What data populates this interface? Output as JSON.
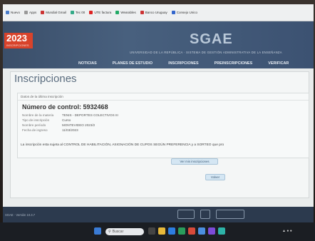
{
  "bookmarks": [
    "Nuevo",
    "Apps",
    "Mundial Gmail",
    "Tec 00",
    "UTE factura",
    "Wearables",
    "Banco Uruguay",
    "Consejo Unico"
  ],
  "header": {
    "year": "2023",
    "year_sub": "INSCRIPCIONES",
    "logo": "SGAE",
    "subtitle": "UNIVERSIDAD DE LA REPÚBLICA · SISTEMA DE GESTIÓN ADMINISTRATIVA DE LA ENSEÑANZA",
    "nav": [
      "NOTICIAS",
      "PLANES DE ESTUDIO",
      "INSCRIPCIONES",
      "PREINSCRIPCIONES",
      "VERIFICAR"
    ]
  },
  "page_title": "Inscripciones",
  "card": {
    "heading": "Datos de la última inscripción",
    "control_label": "Número de control:",
    "control_value": "5932468",
    "rows": [
      {
        "label": "Nombre de la materia",
        "value": "TENIS - DEPORTES COLECTIVOS III"
      },
      {
        "label": "Tipo de inscripción",
        "value": "Curso"
      },
      {
        "label": "Nombre período",
        "value": "MONTEVIDEO 2023/2"
      },
      {
        "label": "Fecha de ingreso",
        "value": "11/03/2023"
      }
    ],
    "note": "La inscripción esta sujeta al CONTROL DE HABILITACIÓN, ASIGNACIÓN DE CUPOS SEGÚN PREFERENCIA y a SORTEO que pro"
  },
  "buttons": {
    "view": "Ver mis inscripciones",
    "back": "Volver"
  },
  "footer": {
    "version": "SGAE · Versión 10.3.7"
  },
  "taskbar": {
    "search_placeholder": "Buscar"
  },
  "colors": {
    "header": "#48607e",
    "accent": "#d8432b",
    "footer": "#2c3a4e"
  }
}
